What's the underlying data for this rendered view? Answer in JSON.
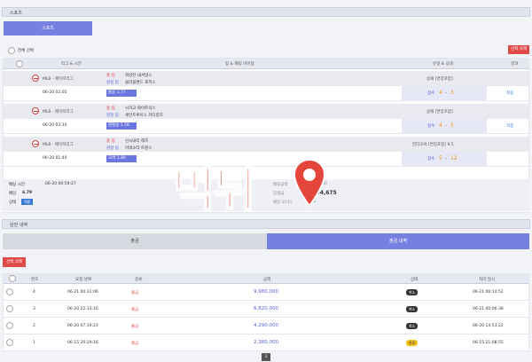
{
  "sports_header": "스포츠",
  "sports_tab": "스포츠",
  "select_all": "전체 선택",
  "delete_selected": "선택 삭제",
  "bet_columns": [
    "리그 & 시간",
    "팀 & 배팅 아이템",
    "유형 & 상태",
    "결과"
  ],
  "league": "MLB - 메이저리그",
  "home_label": "홈 팀",
  "away_label": "원정 팀",
  "matches": [
    {
      "home": "워싱턴 내셔널스",
      "away": "클리블랜드 로키스",
      "time": "06-20 02:05",
      "pick": "홈승 1.77",
      "type": "승패 [연장포함]",
      "score_label": "점수",
      "score_a": "4",
      "score_sep": "-",
      "score_b": "3",
      "result": "적중"
    },
    {
      "home": "시카고 화이트삭스",
      "away": "세인트루이스 카디널즈",
      "time": "06-20 03:10",
      "pick": "원정승 1.58",
      "type": "승패 [연장포함]",
      "score_label": "점수",
      "score_a": "4",
      "score_sep": "-",
      "score_b": "5",
      "result": "적중"
    },
    {
      "home": "신시내티 레즈",
      "away": "미네소타 트윈스",
      "time": "06-20 01:40",
      "pick": "오버 1.80",
      "type": "언더오버 [연장포함] 9.5",
      "score_label": "점수",
      "score_a": "5",
      "score_sep": "-",
      "score_b": "12",
      "result": ""
    }
  ],
  "summary": {
    "bet_time_label": "배팅 시간",
    "bet_time": "06-20 00:59:27",
    "odds_label": "배당",
    "odds": "6.79",
    "status_label": "상태",
    "status": "적중",
    "bet_amount_label": "배팅금액",
    "bet_amount": "1,128,000",
    "win_amount_label": "당첨금",
    "win_amount": "4,294,675",
    "bonus_label": "배당 보너스",
    "bonus": "1.22"
  },
  "watermark": "먹튀",
  "history_header": "완전 내역",
  "tabs": [
    "출금",
    "출금 내역"
  ],
  "history_delete": "선택 삭제",
  "history_columns": [
    "번호",
    "요청 날짜",
    "종류",
    "금액",
    "상태",
    "처리 일시"
  ],
  "history_rows": [
    {
      "no": "4",
      "date": "06-21 00:31:06",
      "kind": "출금",
      "amount": "9,980,000",
      "status": "취소",
      "processed": "06-21 00:10:52",
      "status_color": "#333333"
    },
    {
      "no": "3",
      "date": "06-20 22:33:16",
      "kind": "출금",
      "amount": "6,820,000",
      "status": "취소",
      "processed": "06-21 00:06:38",
      "status_color": "#333333"
    },
    {
      "no": "2",
      "date": "06-20 07:19:23",
      "kind": "출금",
      "amount": "4,290,000",
      "status": "취소",
      "processed": "06-20 14:53:22",
      "status_color": "#333333"
    },
    {
      "no": "1",
      "date": "06-15 20:29:16",
      "kind": "출금",
      "amount": "2,380,000",
      "status": "완료",
      "processed": "06-15 21:08:55",
      "status_color": "#f2c21a"
    }
  ],
  "page": "1",
  "colors": {
    "accent": "#7680e0",
    "danger": "#e24a4a",
    "amount": "#5a60d6"
  }
}
